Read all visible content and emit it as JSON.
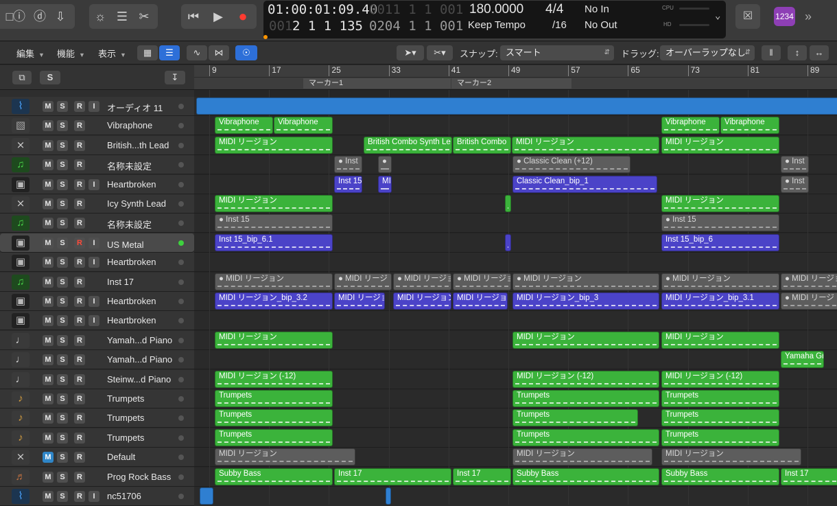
{
  "lcd": {
    "time": "01:00:01:09.40",
    "bars_dim": "001",
    "bars_main": "2 1 1 135",
    "pos_dim": "0011 1 1 001",
    "pos_main": "0204 1 1 001",
    "tempo": "180.0000",
    "tempo_mode": "Keep Tempo",
    "sig_top": "4/4",
    "sig_bottom": "/16",
    "midi_in": "No In",
    "midi_out": "No Out",
    "cpu_label": "CPU",
    "hd_label": "HD",
    "count_badge": "1234"
  },
  "controls": {
    "edit_menu": "編集",
    "function_menu": "機能",
    "view_menu": "表示",
    "snap_label": "スナップ:",
    "snap_value": "スマート",
    "drag_label": "ドラッグ:",
    "drag_value": "オーバーラップなし"
  },
  "header": {
    "solo_label": "S"
  },
  "ruler": {
    "bars": [
      "9",
      "17",
      "25",
      "33",
      "41",
      "49",
      "57",
      "65",
      "73",
      "81",
      "89"
    ],
    "markers": [
      "マーカー1",
      "マーカー2"
    ]
  },
  "tracks": [
    {
      "name": "オーディオ 11",
      "icon": "waveform",
      "rec": true,
      "inp": true
    },
    {
      "name": "Vibraphone",
      "icon": "speaker",
      "rec": true,
      "inp": false
    },
    {
      "name": "British...th Lead",
      "icon": "synth",
      "rec": true,
      "inp": false
    },
    {
      "name": "名称未設定",
      "icon": "note",
      "rec": true,
      "inp": false
    },
    {
      "name": "Heartbroken",
      "icon": "amp",
      "rec": true,
      "inp": true
    },
    {
      "name": "Icy Synth Lead",
      "icon": "synth",
      "rec": true,
      "inp": false
    },
    {
      "name": "名称未設定",
      "icon": "note",
      "rec": true,
      "inp": false
    },
    {
      "name": "US Metal",
      "icon": "amp",
      "rec": true,
      "inp": true
    },
    {
      "name": "Heartbroken",
      "icon": "amp",
      "rec": true,
      "inp": true
    },
    {
      "name": "Inst 17",
      "icon": "note",
      "rec": true,
      "inp": false
    },
    {
      "name": "Heartbroken",
      "icon": "amp",
      "rec": true,
      "inp": true
    },
    {
      "name": "Heartbroken",
      "icon": "amp",
      "rec": true,
      "inp": true
    },
    {
      "name": "Yamah...d Piano",
      "icon": "piano",
      "rec": true,
      "inp": false
    },
    {
      "name": "Yamah...d Piano",
      "icon": "piano",
      "rec": true,
      "inp": false
    },
    {
      "name": "Steinw...d Piano",
      "icon": "piano",
      "rec": true,
      "inp": false
    },
    {
      "name": "Trumpets",
      "icon": "trumpet",
      "rec": true,
      "inp": false
    },
    {
      "name": "Trumpets",
      "icon": "trumpet",
      "rec": true,
      "inp": false
    },
    {
      "name": "Trumpets",
      "icon": "trumpet",
      "rec": true,
      "inp": false
    },
    {
      "name": "Default",
      "icon": "synth",
      "rec": true,
      "inp": false
    },
    {
      "name": "Prog Rock Bass",
      "icon": "bass",
      "rec": true,
      "inp": false
    },
    {
      "name": "nc51706",
      "icon": "waveform",
      "rec": true,
      "inp": true
    }
  ],
  "track_buttons": {
    "mute": "M",
    "solo": "S",
    "rec": "R",
    "input": "I"
  },
  "regions": [
    {
      "lane": 0,
      "start": 3,
      "end": 1000,
      "type": "bl",
      "label": ""
    },
    {
      "lane": 1,
      "start": 30,
      "end": 115,
      "type": "g",
      "label": "Vibraphone"
    },
    {
      "lane": 1,
      "start": 116,
      "end": 202,
      "type": "g",
      "label": "Vibraphone"
    },
    {
      "lane": 1,
      "start": 681,
      "end": 766,
      "type": "g",
      "label": "Vibraphone"
    },
    {
      "lane": 1,
      "start": 767,
      "end": 853,
      "type": "g",
      "label": "Vibraphone"
    },
    {
      "lane": 2,
      "start": 30,
      "end": 202,
      "type": "g",
      "label": "MIDI リージョン"
    },
    {
      "lane": 2,
      "start": 247,
      "end": 376,
      "type": "g",
      "label": "British Combo Synth Le"
    },
    {
      "lane": 2,
      "start": 377,
      "end": 462,
      "type": "g",
      "label": "British Combo"
    },
    {
      "lane": 2,
      "start": 463,
      "end": 678,
      "type": "g",
      "label": "MIDI リージョン"
    },
    {
      "lane": 2,
      "start": 681,
      "end": 853,
      "type": "g",
      "label": "MIDI リージョン"
    },
    {
      "lane": 3,
      "start": 204,
      "end": 245,
      "type": "gr",
      "label": "● Inst"
    },
    {
      "lane": 3,
      "start": 268,
      "end": 288,
      "type": "gr",
      "label": "●"
    },
    {
      "lane": 3,
      "start": 464,
      "end": 636,
      "type": "gr",
      "label": "● Classic Clean (+12)"
    },
    {
      "lane": 3,
      "start": 855,
      "end": 896,
      "type": "gr",
      "label": "● Inst"
    },
    {
      "lane": 4,
      "start": 204,
      "end": 245,
      "type": "pu",
      "label": "Inst 15"
    },
    {
      "lane": 4,
      "start": 268,
      "end": 288,
      "type": "pu",
      "label": "MI"
    },
    {
      "lane": 4,
      "start": 464,
      "end": 675,
      "type": "pu",
      "label": "Classic Clean_bip_1"
    },
    {
      "lane": 4,
      "start": 855,
      "end": 896,
      "type": "gr",
      "label": "● Inst"
    },
    {
      "lane": 5,
      "start": 30,
      "end": 202,
      "type": "g",
      "label": "MIDI リージョン"
    },
    {
      "lane": 5,
      "start": 453,
      "end": 462,
      "type": "g",
      "label": ""
    },
    {
      "lane": 5,
      "start": 681,
      "end": 853,
      "type": "g",
      "label": "MIDI リージョン"
    },
    {
      "lane": 6,
      "start": 30,
      "end": 202,
      "type": "gr",
      "label": "● Inst 15"
    },
    {
      "lane": 6,
      "start": 681,
      "end": 853,
      "type": "gr",
      "label": "● Inst 15"
    },
    {
      "lane": 7,
      "start": 30,
      "end": 202,
      "type": "pu",
      "label": "Inst 15_bip_6.1"
    },
    {
      "lane": 7,
      "start": 453,
      "end": 462,
      "type": "pu",
      "label": ""
    },
    {
      "lane": 7,
      "start": 681,
      "end": 853,
      "type": "pu",
      "label": "Inst 15_bip_6"
    },
    {
      "lane": 9,
      "start": 30,
      "end": 202,
      "type": "gr",
      "label": "● MIDI リージョン"
    },
    {
      "lane": 9,
      "start": 204,
      "end": 288,
      "type": "gr",
      "label": "● MIDI リージ"
    },
    {
      "lane": 9,
      "start": 290,
      "end": 375,
      "type": "gr",
      "label": "● MIDI リージョ"
    },
    {
      "lane": 9,
      "start": 377,
      "end": 462,
      "type": "gr",
      "label": "● MIDI リージョ"
    },
    {
      "lane": 9,
      "start": 464,
      "end": 678,
      "type": "gr",
      "label": "● MIDI リージョン"
    },
    {
      "lane": 9,
      "start": 681,
      "end": 853,
      "type": "gr",
      "label": "● MIDI リージョン"
    },
    {
      "lane": 9,
      "start": 855,
      "end": 940,
      "type": "gr",
      "label": "● MIDI リージョ"
    },
    {
      "lane": 10,
      "start": 30,
      "end": 202,
      "type": "pu",
      "label": "MIDI リージョン_bip_3.2"
    },
    {
      "lane": 10,
      "start": 204,
      "end": 278,
      "type": "pu",
      "label": "MIDI リージョ"
    },
    {
      "lane": 10,
      "start": 290,
      "end": 375,
      "type": "pu",
      "label": "MIDI リージョン_"
    },
    {
      "lane": 10,
      "start": 377,
      "end": 457,
      "type": "pu",
      "label": "MIDI リージョン"
    },
    {
      "lane": 10,
      "start": 464,
      "end": 678,
      "type": "pu",
      "label": "MIDI リージョン_bip_3"
    },
    {
      "lane": 10,
      "start": 681,
      "end": 853,
      "type": "pu",
      "label": "MIDI リージョン_bip_3.1"
    },
    {
      "lane": 10,
      "start": 855,
      "end": 940,
      "type": "gr",
      "label": "● MIDI リージ"
    },
    {
      "lane": 12,
      "start": 30,
      "end": 202,
      "type": "g",
      "label": "MIDI リージョン"
    },
    {
      "lane": 12,
      "start": 464,
      "end": 678,
      "type": "g",
      "label": "MIDI リージョン"
    },
    {
      "lane": 12,
      "start": 681,
      "end": 853,
      "type": "g",
      "label": "MIDI リージョン"
    },
    {
      "lane": 13,
      "start": 855,
      "end": 918,
      "type": "g",
      "label": "Yamaha Gr"
    },
    {
      "lane": 14,
      "start": 30,
      "end": 202,
      "type": "g",
      "label": "MIDI リージョン (-12)"
    },
    {
      "lane": 14,
      "start": 464,
      "end": 678,
      "type": "g",
      "label": "MIDI リージョン (-12)"
    },
    {
      "lane": 14,
      "start": 681,
      "end": 853,
      "type": "g",
      "label": "MIDI リージョン (-12)"
    },
    {
      "lane": 15,
      "start": 30,
      "end": 202,
      "type": "g",
      "label": "Trumpets"
    },
    {
      "lane": 15,
      "start": 464,
      "end": 678,
      "type": "g",
      "label": "Trumpets"
    },
    {
      "lane": 15,
      "start": 681,
      "end": 853,
      "type": "g",
      "label": "Trumpets"
    },
    {
      "lane": 16,
      "start": 30,
      "end": 202,
      "type": "g",
      "label": "Trumpets"
    },
    {
      "lane": 16,
      "start": 464,
      "end": 647,
      "type": "g",
      "label": "Trumpets"
    },
    {
      "lane": 16,
      "start": 681,
      "end": 853,
      "type": "g",
      "label": "Trumpets"
    },
    {
      "lane": 17,
      "start": 30,
      "end": 202,
      "type": "g",
      "label": "Trumpets"
    },
    {
      "lane": 17,
      "start": 464,
      "end": 678,
      "type": "g",
      "label": "Trumpets"
    },
    {
      "lane": 17,
      "start": 681,
      "end": 853,
      "type": "g",
      "label": "Trumpets"
    },
    {
      "lane": 18,
      "start": 30,
      "end": 235,
      "type": "gr",
      "label": "MIDI リージョン"
    },
    {
      "lane": 18,
      "start": 464,
      "end": 668,
      "type": "gr",
      "label": "MIDI リージョン"
    },
    {
      "lane": 18,
      "start": 681,
      "end": 885,
      "type": "gr",
      "label": "MIDI リージョン"
    },
    {
      "lane": 19,
      "start": 30,
      "end": 202,
      "type": "g",
      "label": "Subby Bass"
    },
    {
      "lane": 19,
      "start": 204,
      "end": 375,
      "type": "g",
      "label": "Inst 17"
    },
    {
      "lane": 19,
      "start": 377,
      "end": 462,
      "type": "g",
      "label": "Inst 17"
    },
    {
      "lane": 19,
      "start": 464,
      "end": 678,
      "type": "g",
      "label": "Subby Bass"
    },
    {
      "lane": 19,
      "start": 681,
      "end": 853,
      "type": "g",
      "label": "Subby Bass"
    },
    {
      "lane": 19,
      "start": 855,
      "end": 940,
      "type": "g",
      "label": "Inst 17"
    },
    {
      "lane": 20,
      "start": 8,
      "end": 28,
      "type": "bl",
      "label": ""
    },
    {
      "lane": 20,
      "start": 279,
      "end": 287,
      "type": "bl",
      "label": ""
    }
  ]
}
